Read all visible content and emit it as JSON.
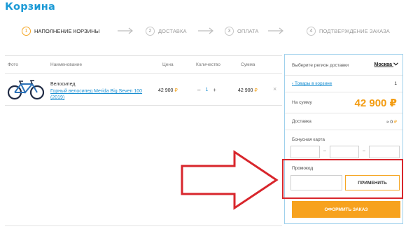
{
  "header": {
    "title": "Корзина"
  },
  "steps": [
    {
      "num": "1",
      "label": "НАПОЛНЕНИЕ КОРЗИНЫ"
    },
    {
      "num": "2",
      "label": "ДОСТАВКА"
    },
    {
      "num": "3",
      "label": "ОПЛАТА"
    },
    {
      "num": "4",
      "label": "ПОДТВЕРЖДЕНИЕ ЗАКАЗА"
    }
  ],
  "table": {
    "headers": {
      "photo": "Фото",
      "name": "Наименование",
      "price": "Цена",
      "qty": "Количество",
      "sum": "Сумма"
    },
    "row": {
      "category": "Велосипед",
      "name": "Горный велосипед Merida Big.Seven 100 (2019)",
      "price": "42 900",
      "currency": "₽",
      "qty_minus": "–",
      "qty": "1",
      "qty_plus": "+",
      "sum": "42 900",
      "remove": "×"
    }
  },
  "sidebar": {
    "region_label": "Выберите регион доставки",
    "region_value": "Москва",
    "items_link": "Товары в корзине",
    "items_count": "1",
    "total_label": "На сумму",
    "total_value": "42 900 ₽",
    "delivery_label": "Доставка",
    "delivery_value": "≈ 0",
    "delivery_currency": "₽",
    "bonus_label": "Бонусная карта",
    "bonus_dash": "–",
    "promo_label": "Промокод",
    "apply_label": "ПРИМЕНИТЬ",
    "order_label": "ОФОРМИТЬ ЗАКАЗ"
  },
  "colors": {
    "accent": "#1b9ad6",
    "orange": "#f7a21e",
    "annotation": "#d8262c"
  }
}
